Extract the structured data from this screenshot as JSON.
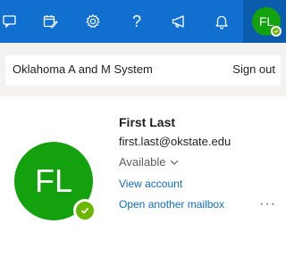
{
  "topbar": {
    "background_color": "#1170cf",
    "icons": [
      "feedback-icon",
      "my-day-icon",
      "settings-icon",
      "help-icon",
      "whats-new-icon",
      "notifications-icon"
    ],
    "help_glyph": "?",
    "avatar_initials": "FL"
  },
  "account": {
    "org_name": "Oklahoma A and M System",
    "sign_out_label": "Sign out",
    "initials": "FL",
    "display_name": "First Last",
    "email": "first.last@okstate.edu",
    "presence": "Available",
    "view_account_label": "View account",
    "open_mailbox_label": "Open another mailbox",
    "more_label": "···",
    "avatar_color": "#13a10e",
    "presence_color": "#6bb700",
    "link_color": "#0f6cbd"
  }
}
